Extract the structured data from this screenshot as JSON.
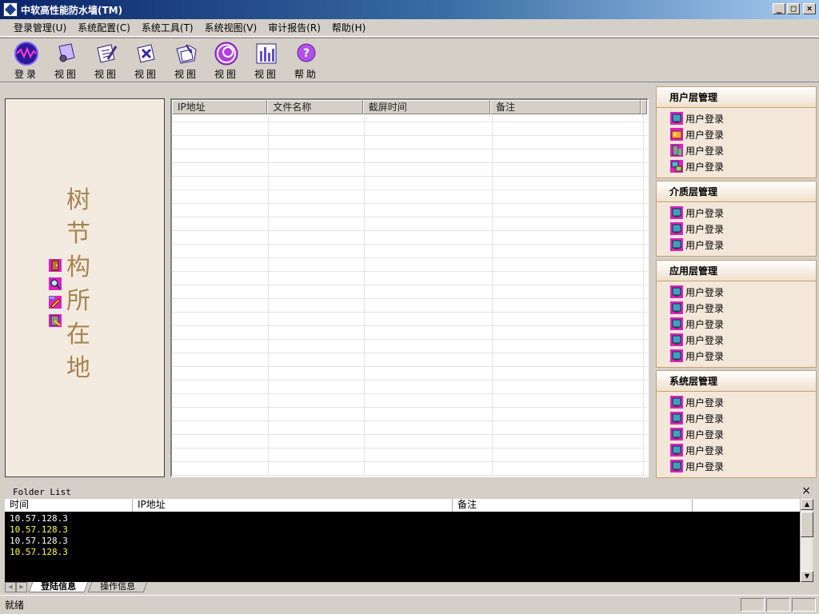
{
  "window": {
    "title": "中软高性能防水墙(TM)",
    "min_label": "_",
    "max_label": "□",
    "close_label": "×"
  },
  "menu": [
    {
      "label": "登录管理(U)"
    },
    {
      "label": "系统配置(C)"
    },
    {
      "label": "系统工具(T)"
    },
    {
      "label": "系统视图(V)"
    },
    {
      "label": "审计报告(R)"
    },
    {
      "label": "帮助(H)"
    }
  ],
  "toolbar": [
    {
      "label": "登录",
      "icon": "login-wave-icon"
    },
    {
      "label": "视图",
      "icon": "pages-view-icon"
    },
    {
      "label": "视图",
      "icon": "pencil-view-icon"
    },
    {
      "label": "视图",
      "icon": "cross-view-icon"
    },
    {
      "label": "视图",
      "icon": "folder-view-icon"
    },
    {
      "label": "视图",
      "icon": "swirl-view-icon"
    },
    {
      "label": "视图",
      "icon": "chart-view-icon"
    },
    {
      "label": "帮助",
      "icon": "help-icon"
    }
  ],
  "tree": {
    "text": "树节构所在地",
    "chars": [
      "树",
      "节",
      "构",
      "所",
      "在",
      "地"
    ],
    "icons": [
      "user-door-icon",
      "magnifier-icon",
      "pencil-edit-icon",
      "user-tool-icon"
    ]
  },
  "grid": {
    "columns": [
      "IP地址",
      "文件名称",
      "截屏时间",
      "备注"
    ],
    "rows": []
  },
  "groups": [
    {
      "title": "用户层管理",
      "items": [
        "用户登录",
        "用户登录",
        "用户登录",
        "用户登录"
      ]
    },
    {
      "title": "介质层管理",
      "items": [
        "用户登录",
        "用户登录",
        "用户登录"
      ]
    },
    {
      "title": "应用层管理",
      "items": [
        "用户登录",
        "用户登录",
        "用户登录",
        "用户登录",
        "用户登录"
      ]
    },
    {
      "title": "系统层管理",
      "items": [
        "用户登录",
        "用户登录",
        "用户登录",
        "用户登录",
        "用户登录"
      ]
    }
  ],
  "folder": {
    "title": "Folder List",
    "close_label": "×",
    "columns": [
      "时间",
      "IP地址",
      "备注"
    ],
    "rows": [
      "10.57.128.3",
      "10.57.128.3",
      "10.57.128.3",
      "10.57.128.3"
    ],
    "tabs": [
      "登陆信息",
      "操作信息"
    ],
    "active_tab": "登陆信息"
  },
  "status": {
    "text": "就绪"
  },
  "colors": {
    "accent": "#0a246a",
    "tree_text": "#a8844f",
    "panel_bg": "#f3e7d9",
    "log_highlight": "#ffff40"
  }
}
